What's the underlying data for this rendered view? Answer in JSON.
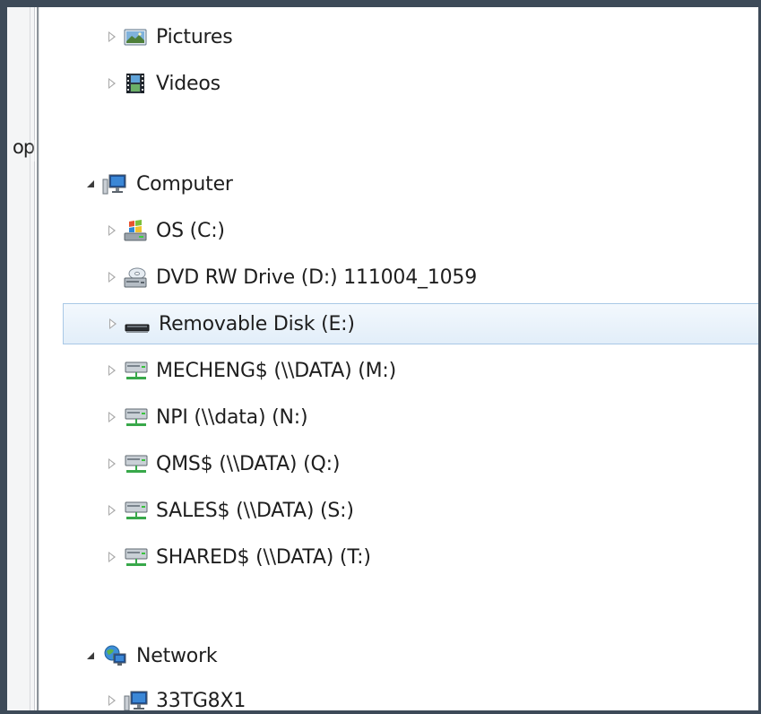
{
  "left_pane": {
    "cut_text": "op"
  },
  "tree": {
    "pictures": {
      "label": "Pictures",
      "icon": "pictures-library-icon"
    },
    "videos": {
      "label": "Videos",
      "icon": "videos-library-icon"
    },
    "computer": {
      "label": "Computer",
      "icon": "computer-icon",
      "expanded": true
    },
    "drive_c": {
      "label": "OS (C:)",
      "icon": "windows-drive-icon"
    },
    "drive_d": {
      "label": "DVD RW Drive (D:) 111004_1059",
      "icon": "dvd-drive-icon"
    },
    "drive_e": {
      "label": "Removable Disk (E:)",
      "icon": "removable-disk-icon",
      "selected": true
    },
    "drive_m": {
      "label": "MECHENG$ (\\\\DATA) (M:)",
      "icon": "network-drive-icon"
    },
    "drive_n": {
      "label": "NPI (\\\\data) (N:)",
      "icon": "network-drive-icon"
    },
    "drive_q": {
      "label": "QMS$ (\\\\DATA) (Q:)",
      "icon": "network-drive-icon"
    },
    "drive_s": {
      "label": "SALES$ (\\\\DATA) (S:)",
      "icon": "network-drive-icon"
    },
    "drive_t": {
      "label": "SHARED$ (\\\\DATA) (T:)",
      "icon": "network-drive-icon"
    },
    "network": {
      "label": "Network",
      "icon": "network-icon",
      "expanded": true
    },
    "host": {
      "label": "33TG8X1",
      "icon": "computer-icon"
    }
  },
  "colors": {
    "frame": "#3d4a58",
    "selection_border": "#a9c8e6",
    "selection_fill": "#e2eef9",
    "text": "#1e1e1e"
  }
}
